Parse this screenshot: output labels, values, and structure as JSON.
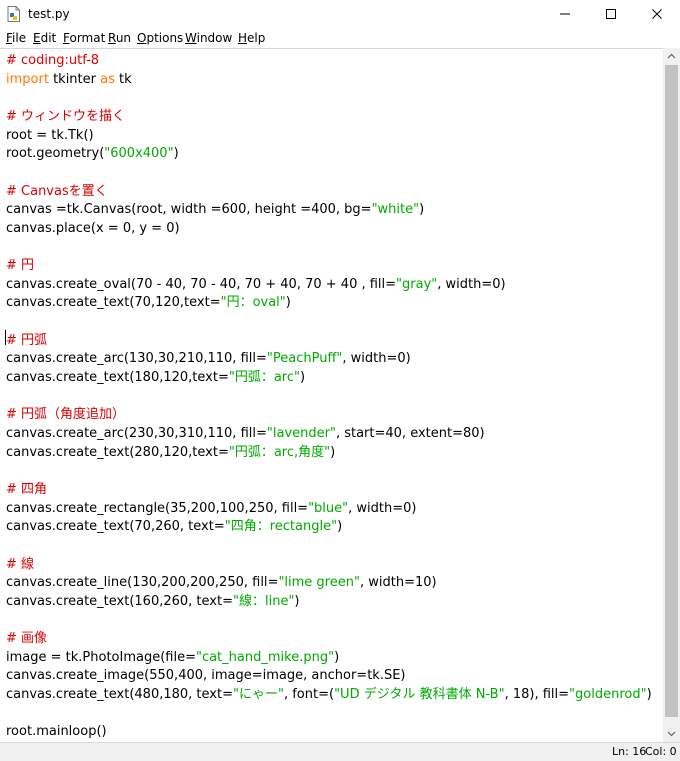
{
  "window": {
    "title": "test.py",
    "icons": {
      "file": "python-file-icon",
      "minimize": "minimize-icon",
      "maximize": "maximize-icon",
      "close": "close-icon"
    }
  },
  "menu": [
    {
      "u": "F",
      "rest": "ile"
    },
    {
      "u": "E",
      "rest": "dit"
    },
    {
      "u": "F",
      "rest": "ormat"
    },
    {
      "u": "R",
      "rest": "un"
    },
    {
      "u": "O",
      "rest": "ptions"
    },
    {
      "u": "W",
      "rest": "indow"
    },
    {
      "u": "H",
      "rest": "elp"
    }
  ],
  "code_lines": [
    [
      {
        "c": "cm",
        "t": "# coding:utf-8"
      }
    ],
    [
      {
        "c": "kw",
        "t": "import"
      },
      {
        "c": "",
        "t": " tkinter "
      },
      {
        "c": "kw",
        "t": "as"
      },
      {
        "c": "",
        "t": " tk"
      }
    ],
    [],
    [
      {
        "c": "cm",
        "t": "# ウィンドウを描く"
      }
    ],
    [
      {
        "c": "",
        "t": "root = tk.Tk()"
      }
    ],
    [
      {
        "c": "",
        "t": "root.geometry("
      },
      {
        "c": "st",
        "t": "\"600x400\""
      },
      {
        "c": "",
        "t": ")"
      }
    ],
    [],
    [
      {
        "c": "cm",
        "t": "# Canvasを置く"
      }
    ],
    [
      {
        "c": "",
        "t": "canvas =tk.Canvas(root, width =600, height =400, bg="
      },
      {
        "c": "st",
        "t": "\"white\""
      },
      {
        "c": "",
        "t": ")"
      }
    ],
    [
      {
        "c": "",
        "t": "canvas.place(x = 0, y = 0)"
      }
    ],
    [],
    [
      {
        "c": "cm",
        "t": "# 円"
      }
    ],
    [
      {
        "c": "",
        "t": "canvas.create_oval(70 - 40, 70 - 40, 70 + 40, 70 + 40 , fill="
      },
      {
        "c": "st",
        "t": "\"gray\""
      },
      {
        "c": "",
        "t": ", width=0)"
      }
    ],
    [
      {
        "c": "",
        "t": "canvas.create_text(70,120,text="
      },
      {
        "c": "st",
        "t": "\"円：oval\""
      },
      {
        "c": "",
        "t": ")"
      }
    ],
    [],
    [
      {
        "c": "cm",
        "t": "# 円弧"
      }
    ],
    [
      {
        "c": "",
        "t": "canvas.create_arc(130,30,210,110, fill="
      },
      {
        "c": "st",
        "t": "\"PeachPuff\""
      },
      {
        "c": "",
        "t": ", width=0)"
      }
    ],
    [
      {
        "c": "",
        "t": "canvas.create_text(180,120,text="
      },
      {
        "c": "st",
        "t": "\"円弧：arc\""
      },
      {
        "c": "",
        "t": ")"
      }
    ],
    [],
    [
      {
        "c": "cm",
        "t": "# 円弧（角度追加）"
      }
    ],
    [
      {
        "c": "",
        "t": "canvas.create_arc(230,30,310,110, fill="
      },
      {
        "c": "st",
        "t": "\"lavender\""
      },
      {
        "c": "",
        "t": ", start=40, extent=80)"
      }
    ],
    [
      {
        "c": "",
        "t": "canvas.create_text(280,120,text="
      },
      {
        "c": "st",
        "t": "\"円弧：arc,角度\""
      },
      {
        "c": "",
        "t": ")"
      }
    ],
    [],
    [
      {
        "c": "cm",
        "t": "# 四角"
      }
    ],
    [
      {
        "c": "",
        "t": "canvas.create_rectangle(35,200,100,250, fill="
      },
      {
        "c": "st",
        "t": "\"blue\""
      },
      {
        "c": "",
        "t": ", width=0)"
      }
    ],
    [
      {
        "c": "",
        "t": "canvas.create_text(70,260, text="
      },
      {
        "c": "st",
        "t": "\"四角：rectangle\""
      },
      {
        "c": "",
        "t": ")"
      }
    ],
    [],
    [
      {
        "c": "cm",
        "t": "# 線"
      }
    ],
    [
      {
        "c": "",
        "t": "canvas.create_line(130,200,200,250, fill="
      },
      {
        "c": "st",
        "t": "\"lime green\""
      },
      {
        "c": "",
        "t": ", width=10)"
      }
    ],
    [
      {
        "c": "",
        "t": "canvas.create_text(160,260, text="
      },
      {
        "c": "st",
        "t": "\"線：line\""
      },
      {
        "c": "",
        "t": ")"
      }
    ],
    [],
    [
      {
        "c": "cm",
        "t": "# 画像"
      }
    ],
    [
      {
        "c": "",
        "t": "image = tk.PhotoImage(file="
      },
      {
        "c": "st",
        "t": "\"cat_hand_mike.png\""
      },
      {
        "c": "",
        "t": ")"
      }
    ],
    [
      {
        "c": "",
        "t": "canvas.create_image(550,400, image=image, anchor=tk.SE)"
      }
    ],
    [
      {
        "c": "",
        "t": "canvas.create_text(480,180, text="
      },
      {
        "c": "st",
        "t": "\"にゃー\""
      },
      {
        "c": "",
        "t": ", font=("
      },
      {
        "c": "st",
        "t": "\"UD デジタル 教科書体 N-B\""
      },
      {
        "c": "",
        "t": ", 18), fill="
      },
      {
        "c": "st",
        "t": "\"goldenrod\""
      },
      {
        "c": "",
        "t": ")"
      }
    ],
    [],
    [
      {
        "c": "",
        "t": "root.mainloop()"
      }
    ]
  ],
  "status": {
    "line": "Ln: 16",
    "col": "Col: 0"
  },
  "colors": {
    "keyword": "#ff7700",
    "comment": "#dd0000",
    "string": "#00aa00"
  }
}
